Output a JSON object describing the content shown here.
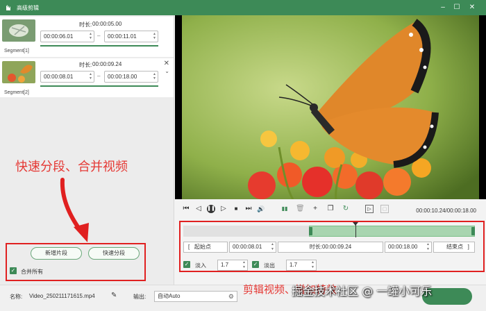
{
  "window": {
    "title": "高级剪辑",
    "min_icon": "minimize-icon",
    "max_icon": "maximize-icon",
    "close_icon": "close-icon"
  },
  "segments": [
    {
      "label": "Segment[1]",
      "duration_label": "时长:",
      "duration": "00:00:05.00",
      "start": "00:00:06.01",
      "end": "00:00:11.01"
    },
    {
      "label": "Segment[2]",
      "duration_label": "时长:",
      "duration": "00:00:09.24",
      "start": "00:00:08.01",
      "end": "00:00:18.00"
    }
  ],
  "annotations": {
    "left": "快速分段、合并视频",
    "right": "剪辑视频、增加特效"
  },
  "watermark": "掘金技术社区 @ 一罐小可乐",
  "left_panel": {
    "add_segment": "新增片段",
    "quick_split": "快速分段",
    "merge_all": "合并所有"
  },
  "player": {
    "timecode": "00:00:10.24/00:00:18.00"
  },
  "editor": {
    "start_point_label": "起始点",
    "start_value": "00:00:08.01",
    "duration_label": "时长:",
    "duration_value": "00:00:09.24",
    "end_value": "00:00:18.00",
    "end_point_label": "结束点",
    "fade_in_label": "淡入",
    "fade_in_value": "1.7",
    "fade_out_label": "淡出",
    "fade_out_value": "1.7",
    "track_selection": {
      "start_fraction": 0.43,
      "end_fraction": 1.0,
      "playhead_fraction": 0.59
    }
  },
  "bottom": {
    "name_label": "名称:",
    "file_name": "Video_250211171615.mp4",
    "output_label": "输出:",
    "output_value": "自动Auto"
  },
  "colors": {
    "accent": "#3d8a57",
    "highlight": "#e02020"
  }
}
